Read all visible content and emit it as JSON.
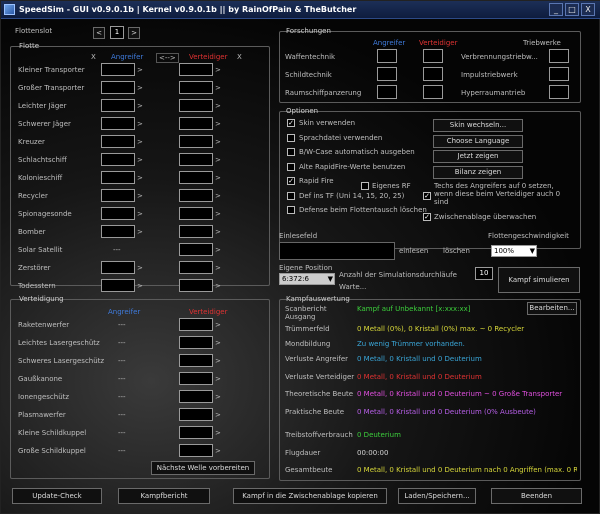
{
  "window": {
    "title": "SpeedSim - GUI v0.9.0.1b | Kernel v0.9.0.1b || by RainOfPain & TheButcher",
    "min": "_",
    "max": "□",
    "close": "X"
  },
  "flotten": {
    "slot_label": "Flottenslot",
    "slot_value": "1",
    "prev": "<",
    "next": ">",
    "title": "Flotte",
    "attacker": "Angreifer",
    "swap": "<-->",
    "defender": "Verteidiger",
    "clear": "X",
    "ships": [
      "Kleiner Transporter",
      "Großer Transporter",
      "Leichter Jäger",
      "Schwerer Jäger",
      "Kreuzer",
      "Schlachtschiff",
      "Kolonieschiff",
      "Recycler",
      "Spionagesonde",
      "Bomber",
      "Solar Satellit",
      "Zerstörer",
      "Todesstern"
    ],
    "solar_attacker": "---"
  },
  "verteidigung": {
    "title": "Verteidigung",
    "attacker": "Angreifer",
    "defender": "Verteidiger",
    "items": [
      "Raketenwerfer",
      "Leichtes Lasergeschütz",
      "Schweres Lasergeschütz",
      "Gaußkanone",
      "Ionengeschütz",
      "Plasmawerfer",
      "Kleine Schildkuppel",
      "Große Schildkuppel"
    ],
    "dash": "---",
    "next_wave": "Nächste Welle vorbereiten"
  },
  "forschungen": {
    "title": "Forschungen",
    "attacker": "Angreifer",
    "defender": "Verteidiger",
    "engines": "Triebwerke",
    "rows": [
      "Waffentechnik",
      "Schildtechnik",
      "Raumschiffpanzerung"
    ],
    "engine_rows": [
      "Verbrennungstriebw...",
      "Impulstriebwerk",
      "Hyperraumantrieb"
    ]
  },
  "optionen": {
    "title": "Optionen",
    "checks": [
      {
        "label": "Skin verwenden",
        "checked": true
      },
      {
        "label": "Sprachdatei verwenden",
        "checked": false
      },
      {
        "label": "B/W-Case automatisch ausgeben",
        "checked": false
      },
      {
        "label": "Alte RapidFire-Werte benutzen",
        "checked": false
      },
      {
        "label": "Rapid Fire",
        "checked": true
      },
      {
        "label": "Def ins TF (Uni 14, 15, 20, 25)",
        "checked": false
      },
      {
        "label": "Defense beim Flottentausch löschen",
        "checked": false
      }
    ],
    "eigenes_rf": "Eigenes RF",
    "techs_label": "Techs des Angreifers auf 0 setzen, wenn diese beim Verteidiger auch 0 sind",
    "clipboard_label": "Zwischenablage überwachen",
    "buttons": [
      "Skin wechseln...",
      "Choose Language",
      "Jetzt zeigen",
      "Bilanz zeigen"
    ]
  },
  "einlesefeld": {
    "title": "Einlesefeld",
    "read": "einlesen",
    "delete": "löschen",
    "speed_label": "Flottengeschwindigkeit",
    "speed_value": "100%"
  },
  "position": {
    "title": "Eigene Position",
    "value": "6:372:6",
    "sims_label": "Anzahl der Simulationsdurchläufe",
    "sims_value": "10",
    "wait": "Warte...",
    "simulate": "Kampf simulieren"
  },
  "kampf": {
    "title": "Kampfauswertung",
    "rows": [
      {
        "label": "Scanbericht\nAusgang",
        "value": "Kampf auf Unbekannt [x:xxx:xx]",
        "color": "green"
      },
      {
        "label": "Trümmerfeld",
        "value": "0 Metall (0%), 0 Kristall (0%) max. ~ 0 Recycler",
        "color": "yellow"
      },
      {
        "label": "Mondbildung",
        "value": "Zu wenig Trümmer vorhanden.",
        "color": "cyan"
      },
      {
        "label": "Verluste Angreifer",
        "value": "0 Metall, 0 Kristall und 0 Deuterium",
        "color": "cyan"
      },
      {
        "label": "Verluste Verteidiger",
        "value": "0 Metall, 0 Kristall und 0 Deuterium",
        "color": "red"
      },
      {
        "label": "Theoretische Beute",
        "value": "0 Metall, 0 Kristall und 0 Deuterium ~ 0 Große Transporter",
        "color": "pink"
      },
      {
        "label": "Praktische Beute",
        "value": "0 Metall, 0 Kristall und 0 Deuterium (0% Ausbeute)",
        "color": "purple"
      },
      {
        "label": "Treibstoffverbrauch",
        "value": "0 Deuterium",
        "color": "green"
      },
      {
        "label": "Flugdauer",
        "value": "00:00:00",
        "color": "white"
      },
      {
        "label": "Gesamtbeute",
        "value": "0 Metall, 0 Kristall und 0 Deuterium nach 0 Angriffen (max. 0 R",
        "color": "yellow"
      }
    ],
    "edit": "Bearbeiten..."
  },
  "footer": [
    "Update-Check",
    "Kampfbericht",
    "Kampf in die Zwischenablage kopieren",
    "Laden/Speichern...",
    "Beenden"
  ],
  "colors": {
    "attacker": "#3f7bdc",
    "defender": "#e03232"
  }
}
